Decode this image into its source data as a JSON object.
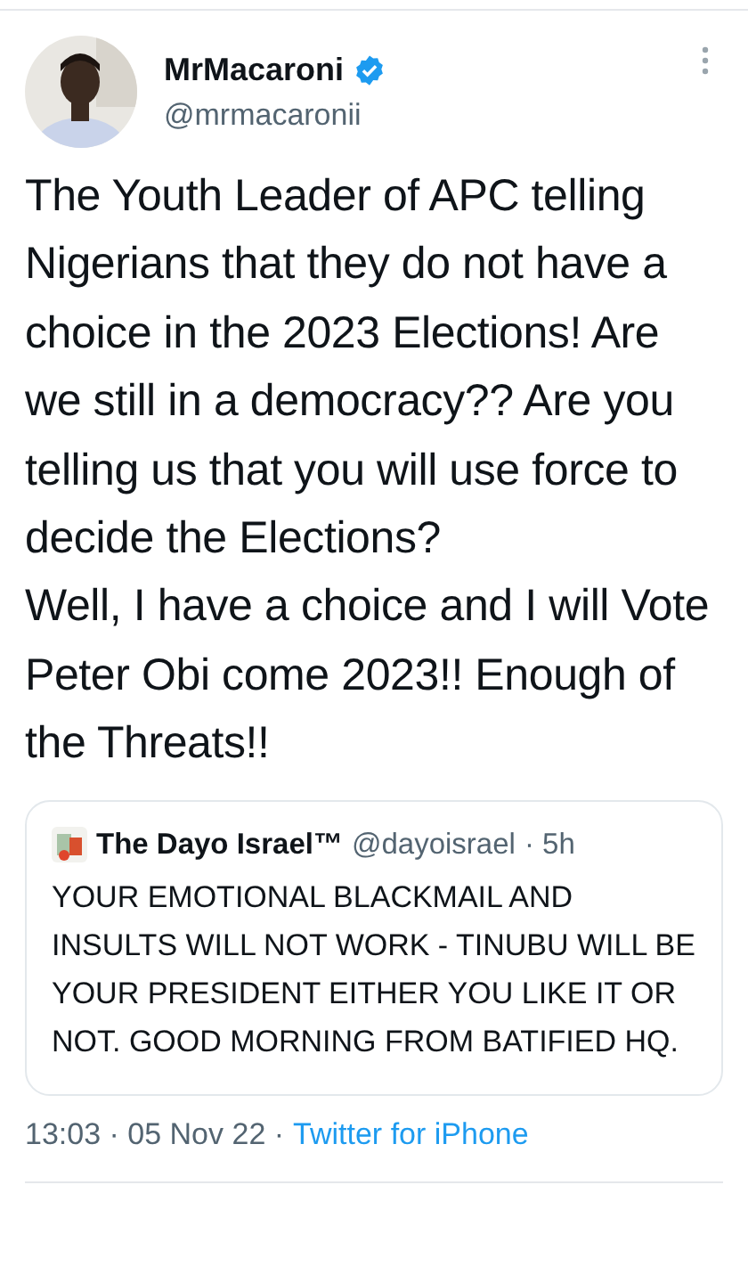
{
  "author": {
    "name": "MrMacaroni",
    "verified": true,
    "handle": "@mrmacaronii"
  },
  "tweet_text": "The Youth Leader of APC telling Nigerians that they do not have a choice in the 2023 Elections! Are we still in a democracy?? Are you telling us that you will use force to decide the Elections?\nWell, I have a choice and I will Vote Peter Obi come 2023!! Enough of the Threats!!",
  "quoted_tweet": {
    "name": "The Dayo Israel™",
    "handle": "@dayoisrael",
    "age": "· 5h",
    "text": "YOUR EMOTIONAL BLACKMAIL AND INSULTS WILL NOT WORK - TINUBU WILL BE YOUR PRESIDENT EITHER YOU LIKE IT OR NOT. GOOD MORNING FROM BATIFIED HQ."
  },
  "footer": {
    "time": "13:03 · 05 Nov 22 ·",
    "source": "Twitter for iPhone"
  }
}
